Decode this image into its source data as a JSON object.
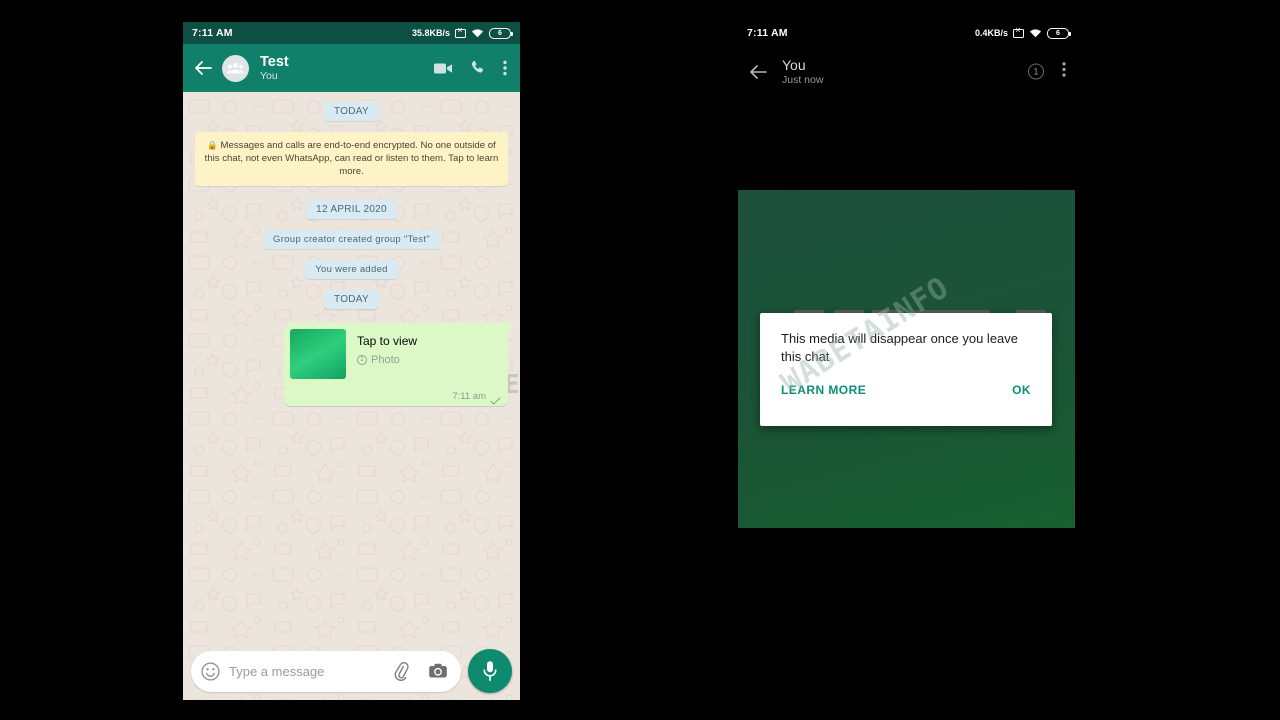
{
  "left_phone": {
    "statusbar": {
      "time": "7:11 AM",
      "network_speed": "35.8KB/s",
      "battery_level": "6",
      "icons": [
        "no-sim-icon",
        "wifi-icon",
        "battery-icon"
      ]
    },
    "appbar": {
      "back_icon": "back-arrow-icon",
      "avatar_icon": "group-avatar-icon",
      "title": "Test",
      "subtitle": "You",
      "icons": [
        "video-call-icon",
        "voice-call-icon",
        "overflow-menu-icon"
      ]
    },
    "messages": [
      {
        "type": "date-chip",
        "text": "TODAY"
      },
      {
        "type": "encryption-notice",
        "lock": "lock-icon",
        "text": "Messages and calls are end-to-end encrypted. No one outside of this chat, not even WhatsApp, can read or listen to them. Tap to learn more."
      },
      {
        "type": "date-chip",
        "text": "12 APRIL 2020"
      },
      {
        "type": "system-chip",
        "text": "Group creator created group \"Test\""
      },
      {
        "type": "system-chip",
        "text": "You were added"
      },
      {
        "type": "date-chip",
        "text": "TODAY"
      }
    ],
    "outgoing_bubble": {
      "thumbnail": "view-once-photo-thumbnail",
      "primary_text": "Tap to view",
      "media_type_icon": "view-once-badge-icon",
      "media_type_label": "Photo",
      "timestamp": "7:11 am",
      "status_icon": "single-check-icon"
    },
    "composer": {
      "emoji_icon": "smiley-icon",
      "placeholder": "Type a message",
      "attach_icon": "paperclip-icon",
      "camera_icon": "camera-icon",
      "mic_icon": "microphone-icon"
    }
  },
  "right_phone": {
    "statusbar": {
      "time": "7:11 AM",
      "network_speed": "0.4KB/s",
      "battery_level": "6",
      "icons": [
        "no-sim-icon",
        "wifi-icon",
        "battery-icon"
      ]
    },
    "appbar": {
      "back_icon": "back-arrow-icon",
      "title": "You",
      "subtitle": "Just now",
      "view_once_badge": "1",
      "overflow_icon": "overflow-menu-icon"
    },
    "viewer": {
      "media_placeholder": "view-once-media-green"
    },
    "dialog": {
      "message": "This media will disappear once you leave this chat",
      "learn_more_label": "LEARN MORE",
      "ok_label": "OK"
    }
  },
  "watermark": {
    "text": "WABETAINFO"
  },
  "colors": {
    "whatsapp_teal": "#11806a",
    "statusbar_teal": "#0d4f43",
    "outgoing_bubble": "#dcf8c6",
    "system_chip": "#d9eaf2",
    "encryption_chip": "#fdf3c6",
    "chat_background": "#ece5dd",
    "dialog_accent": "#0b8f77",
    "viewer_green": "#1b5437"
  }
}
